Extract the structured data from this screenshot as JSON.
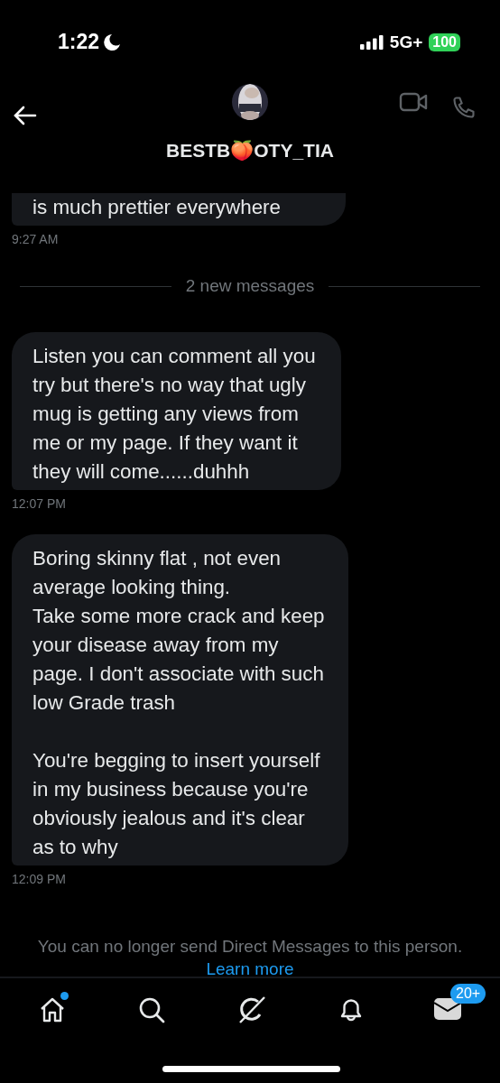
{
  "status_bar": {
    "time": "1:22",
    "network": "5G+",
    "battery": "100"
  },
  "header": {
    "username": "BESTB🍑OTY_TIA"
  },
  "thread": [
    {
      "kind": "message",
      "text": "is much prettier everywhere",
      "time": "9:27 AM",
      "cut_top": true
    },
    {
      "kind": "divider",
      "text": "2 new messages"
    },
    {
      "kind": "message",
      "text": "Listen you can comment all you try but there's no way that ugly mug is getting any views from me or my page. If they want it they will come......duhhh",
      "time": "12:07 PM",
      "cut_top": false
    },
    {
      "kind": "message",
      "text": "Boring skinny flat , not even average looking thing.\nTake some more crack and keep your disease away from my page. I don't associate with such low Grade trash\n\nYou're begging to insert yourself in my business because you're obviously jealous and it's clear as to why",
      "time": "12:09 PM",
      "cut_top": false
    }
  ],
  "notice": {
    "text": "You can no longer send Direct Messages to this person.",
    "link": "Learn more"
  },
  "nav": [
    {
      "kind": "home",
      "dot": true
    },
    {
      "kind": "search",
      "dot": false
    },
    {
      "kind": "grok",
      "dot": false
    },
    {
      "kind": "notifications",
      "dot": false
    },
    {
      "kind": "messages",
      "dot": false,
      "badge": "20+"
    }
  ]
}
